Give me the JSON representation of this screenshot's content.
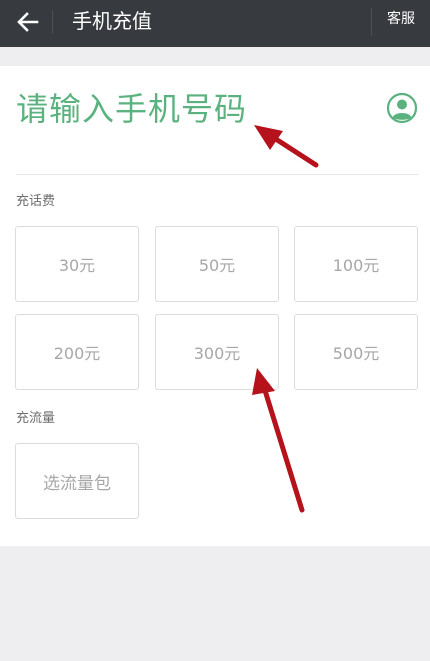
{
  "header": {
    "title": "手机充值",
    "service_label": "客服"
  },
  "phone": {
    "placeholder": "请输入手机号码"
  },
  "recharge": {
    "label": "充话费",
    "amounts": [
      "30元",
      "50元",
      "100元",
      "200元",
      "300元",
      "500元"
    ]
  },
  "data_plan": {
    "label": "充流量",
    "button_label": "选流量包"
  },
  "colors": {
    "topbar": "#373a3e",
    "accent_green": "#5bb27f",
    "arrow_red": "#b5121b"
  },
  "icons": {
    "back": "arrow-left-icon",
    "contact": "contact-person-icon"
  }
}
